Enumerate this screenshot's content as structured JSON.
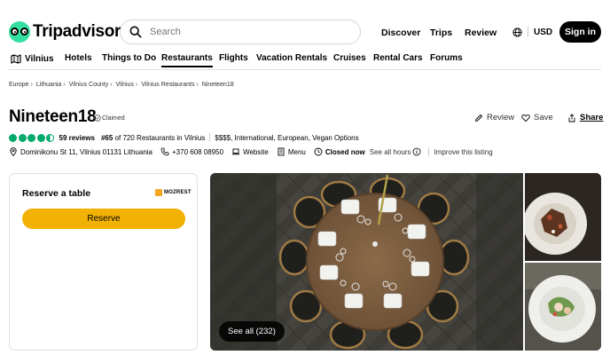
{
  "header": {
    "logo_text": "Tripadvisor",
    "search_placeholder": "Search",
    "nav": {
      "discover": "Discover",
      "trips": "Trips",
      "review": "Review"
    },
    "currency": "USD",
    "sign_in": "Sign in"
  },
  "subnav": {
    "city": "Vilnius",
    "items": [
      "Hotels",
      "Things to Do",
      "Restaurants",
      "Flights",
      "Vacation Rentals",
      "Cruises",
      "Rental Cars",
      "Forums"
    ],
    "active": "Restaurants"
  },
  "breadcrumb": [
    "Europe",
    "Lithuania",
    "Vilnius County",
    "Vilnius",
    "Vilnius Restaurants",
    "Nineteen18"
  ],
  "restaurant": {
    "name": "Nineteen18",
    "claimed": "Claimed",
    "rating": 4.5,
    "reviews": "59 reviews",
    "rank_num": "#65",
    "rank_rest": "of 720 Restaurants in Vilnius",
    "cuisine": "$$$$, International, European, Vegan Options",
    "address": "Dominikonu St 11, Vilnius 01131 Lithuania",
    "phone": "+370 608 08950",
    "website": "Website",
    "menu": "Menu",
    "status": "Closed now",
    "see_hours": "See all hours",
    "improve": "Improve this listing"
  },
  "actions": {
    "review": "Review",
    "save": "Save",
    "share": "Share"
  },
  "reserve": {
    "title": "Reserve a table",
    "partner": "MOZREST",
    "button": "Reserve"
  },
  "photos": {
    "see_all": "See all (232)"
  },
  "colors": {
    "brand_green": "#34e0a1",
    "rating_green": "#00aa6c",
    "reserve_yellow": "#f2b203"
  }
}
